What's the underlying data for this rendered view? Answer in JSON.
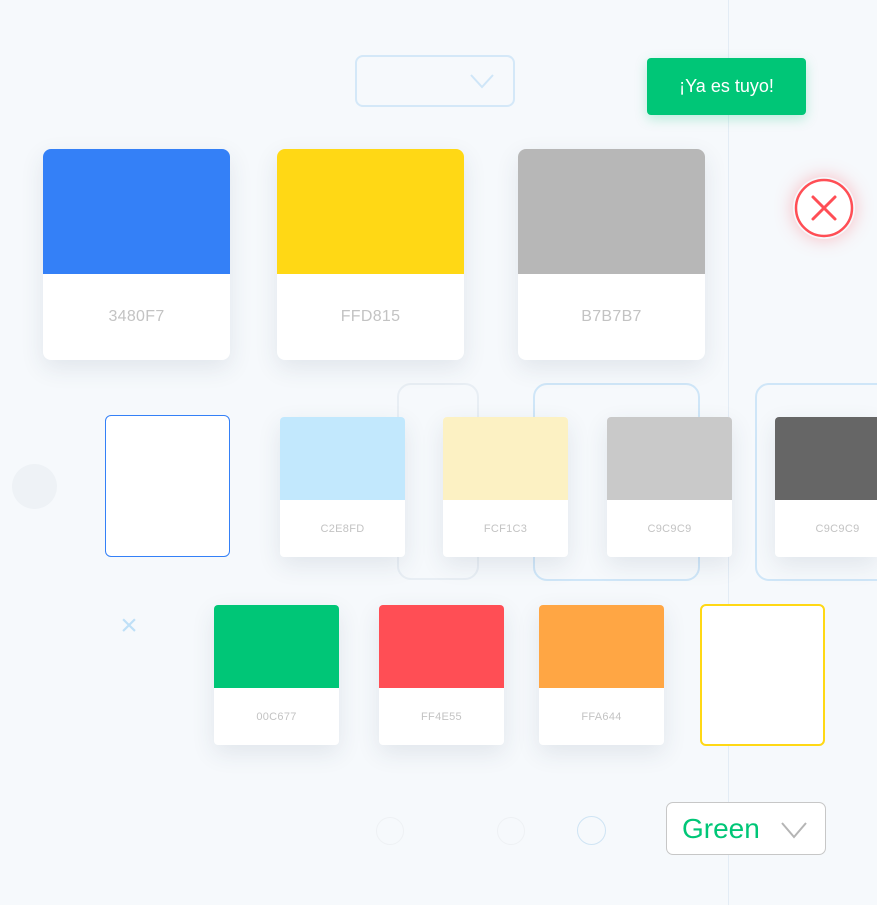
{
  "toast": {
    "text": "¡Ya es tuyo!"
  },
  "colors": {
    "accent_green": "#00C677",
    "close_red": "#FF4E55",
    "selected_blue": "#3480F7",
    "selected_yellow": "#FFD815"
  },
  "icons": {
    "close": "close-circle-icon",
    "chevron": "chevron-down-icon",
    "decorative_x": "x-icon"
  },
  "palette_large": [
    {
      "code": "3480F7",
      "color": "#3480F7"
    },
    {
      "code": "FFD815",
      "color": "#FFD815"
    },
    {
      "code": "B7B7B7",
      "color": "#B7B7B7"
    }
  ],
  "palette_row2": [
    {
      "code": "",
      "color": "#FFFFFF",
      "selected": true
    },
    {
      "code": "C2E8FD",
      "color": "#C2E8FD"
    },
    {
      "code": "FCF1C3",
      "color": "#FCF1C3"
    },
    {
      "code": "C9C9C9",
      "color": "#C9C9C9"
    },
    {
      "code": "C9C9C9",
      "color": "#666666"
    }
  ],
  "palette_row3": [
    {
      "code": "00C677",
      "color": "#00C677"
    },
    {
      "code": "FF4E55",
      "color": "#FF4E55"
    },
    {
      "code": "FFA644",
      "color": "#FFA644"
    },
    {
      "code": "",
      "color": "#FFFFFF",
      "selected": true
    }
  ],
  "dropdown": {
    "selected": "Green"
  }
}
